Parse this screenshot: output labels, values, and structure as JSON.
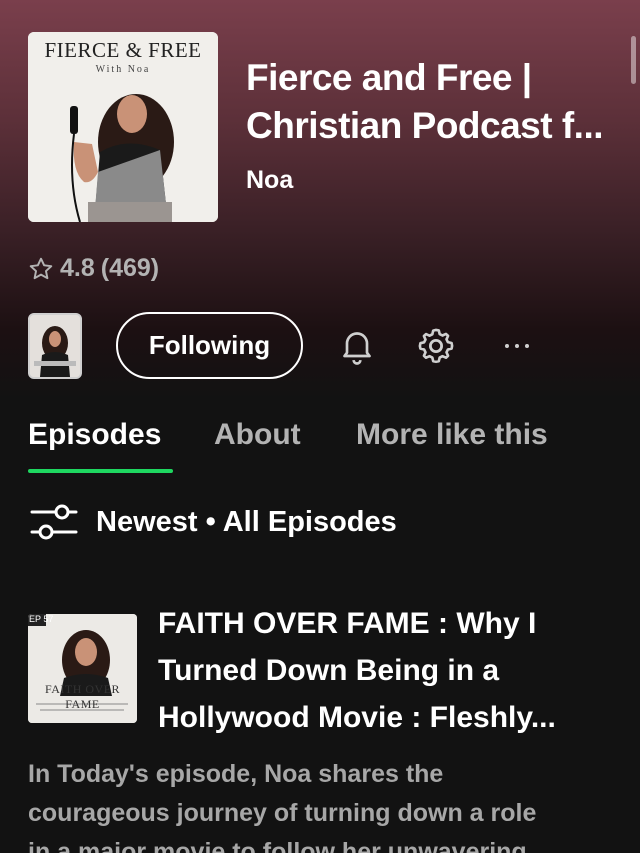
{
  "podcast": {
    "cover_title": "FIERCE & FREE",
    "cover_subtitle": "With Noa",
    "title_line1": "Fierce and Free |",
    "title_line2": "Christian Podcast f...",
    "author": "Noa",
    "rating": "4.8",
    "rating_count": "(469)"
  },
  "actions": {
    "follow_label": "Following",
    "icons": [
      "bell-icon",
      "gear-icon",
      "more-icon",
      "star-icon"
    ]
  },
  "tabs": [
    {
      "label": "Episodes",
      "active": true
    },
    {
      "label": "About",
      "active": false
    },
    {
      "label": "More like this",
      "active": false
    }
  ],
  "filter": {
    "label": "Newest • All Episodes"
  },
  "episode": {
    "art_badge": "EP 57",
    "art_text": "FAITH OVER FAME",
    "title_lines": [
      "FAITH OVER FAME : Why I",
      "Turned Down Being in a",
      "Hollywood Movie : Fleshly..."
    ],
    "description_lines": [
      "In Today's episode, Noa shares the",
      "courageous journey of turning down a role",
      "in a major movie to follow her unwavering"
    ]
  },
  "colors": {
    "accent": "#1ed760",
    "background": "#121212",
    "header_tint": "#7a3f4c",
    "muted_text": "#b3b3b3"
  }
}
